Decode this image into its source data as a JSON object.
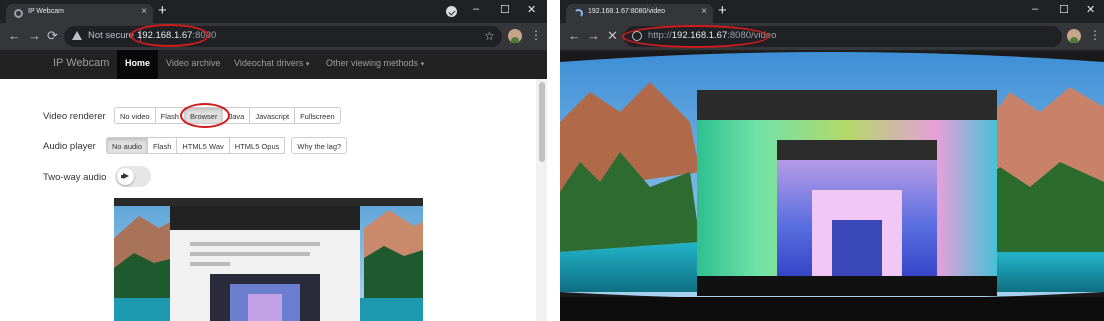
{
  "left": {
    "tab": {
      "title": "IP Webcam",
      "close": "×"
    },
    "newtab": "+",
    "window_controls": {
      "minimize": "–",
      "maximize": "☐",
      "close": "✕"
    },
    "nav_buttons": {
      "back": "←",
      "forward": "→",
      "reload": "⟳"
    },
    "omnibox": {
      "security": "Not secure",
      "host": "192.168.1.67",
      "port": ":8080"
    },
    "star": "☆",
    "menu": "⋮",
    "page": {
      "brand": "IP Webcam",
      "nav": [
        "Home",
        "Video archive",
        "Videochat drivers",
        "Other viewing methods"
      ],
      "caret": "▾",
      "video_renderer": {
        "label": "Video renderer",
        "options": [
          "No video",
          "Flash",
          "Browser",
          "Java",
          "Javascript",
          "Fullscreen"
        ],
        "selected": "Browser"
      },
      "audio_player": {
        "label": "Audio player",
        "options": [
          "No audio",
          "Flash",
          "HTML5 Wav",
          "HTML5 Opus"
        ],
        "selected": "No audio",
        "help_button": "Why the lag?"
      },
      "two_way_audio": {
        "label": "Two-way audio",
        "enabled": false
      }
    }
  },
  "right": {
    "tab": {
      "title": "192.168.1.67:8080/video",
      "close": "×"
    },
    "newtab": "+",
    "window_controls": {
      "minimize": "–",
      "maximize": "☐",
      "close": "✕"
    },
    "nav_buttons": {
      "back": "←",
      "forward": "→",
      "stop": "✕"
    },
    "omnibox": {
      "scheme": "http://",
      "host": "192.168.1.67",
      "path": ":8080/video"
    },
    "menu": "⋮"
  },
  "colors": {
    "callout": "#d21c1c",
    "chrome_dark": "#202124",
    "chrome_toolbar": "#35363a",
    "navbar": "#222222"
  }
}
